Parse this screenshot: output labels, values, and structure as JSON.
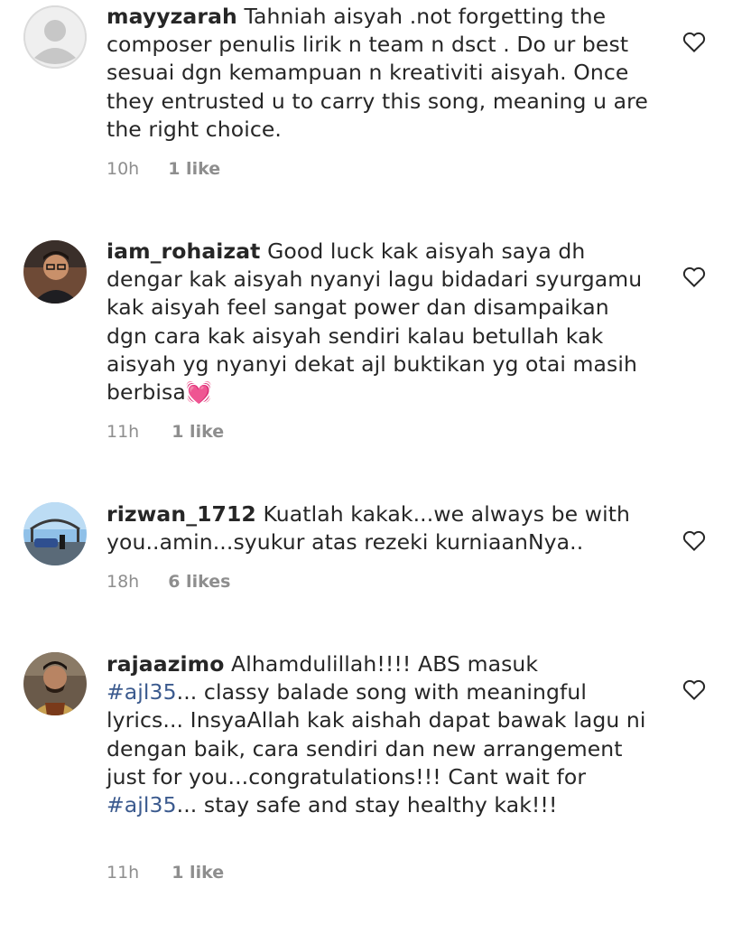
{
  "comments": [
    {
      "username": "mayyzarah",
      "text_before": " Tahniah aisyah .not forgetting  the composer penulis lirik n team n dsct . Do ur best sesuai dgn kemampuan n kreativiti aisyah. Once they entrusted u to carry this song, meaning u are the right choice.",
      "time": "10h",
      "likes": "1 like",
      "avatar": "default-avatar-icon"
    },
    {
      "username": "iam_rohaizat",
      "text_before": " Good luck kak aisyah saya dh dengar kak aisyah nyanyi lagu bidadari syurgamu kak aisyah feel sangat power dan disampaikan dgn cara kak aisyah sendiri kalau betullah kak aisyah yg nyanyi dekat ajl buktikan yg otai masih berbisa",
      "emoji": "💓",
      "time": "11h",
      "likes": "1 like",
      "avatar": "user-photo-avatar"
    },
    {
      "username": "rizwan_1712",
      "text_before": " Kuatlah kakak...we always be with you..amin...syukur atas rezeki kurniaanNya..",
      "time": "18h",
      "likes": "6 likes",
      "avatar": "user-photo-avatar"
    },
    {
      "username": "rajaazimo",
      "text_before": " Alhamdulillah!!!! ABS masuk\n",
      "hashtag1": "#ajl35",
      "text_middle": "... classy balade song with meaningful lyrics... InsyaAllah kak aishah dapat bawak lagu ni dengan baik, cara sendiri dan new arrangement just for you...congratulations!!! Cant wait for ",
      "hashtag2": "#ajl35",
      "text_after": "... stay safe and stay healthy kak!!!",
      "time": "11h",
      "likes": "1 like",
      "avatar": "user-photo-avatar"
    }
  ],
  "colors": {
    "text": "#262626",
    "meta": "#8e8e8e",
    "hashtag": "#3b5a8e"
  }
}
